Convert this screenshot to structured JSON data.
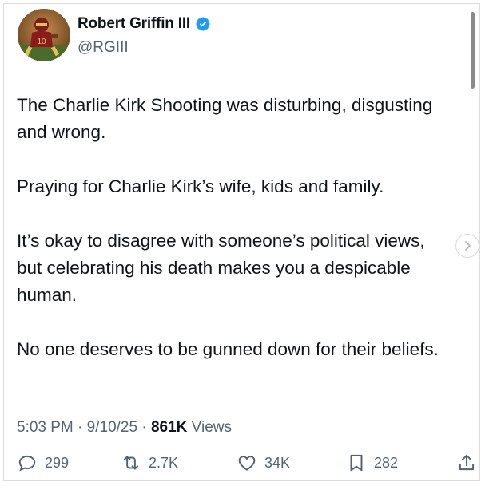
{
  "author": {
    "name": "Robert Griffin III",
    "handle": "@RGIII",
    "verified_icon": "verified-badge-icon"
  },
  "post": {
    "paragraphs": [
      "The Charlie Kirk Shooting was disturbing, disgusting and wrong.",
      "Praying for Charlie Kirk’s wife, kids and family.",
      "It’s okay to disagree with someone’s political views, but celebrating his death makes you a despicable human.",
      "No one deserves to be gunned down for their beliefs."
    ]
  },
  "meta": {
    "time": "5:03 PM",
    "separator": "·",
    "date": "9/10/25",
    "views_count": "861K",
    "views_label": "Views"
  },
  "actions": {
    "replies": "299",
    "reposts": "2.7K",
    "likes": "34K",
    "bookmarks": "282"
  },
  "colors": {
    "text": "#0f1419",
    "muted": "#536471",
    "verified": "#1d9bf0"
  }
}
